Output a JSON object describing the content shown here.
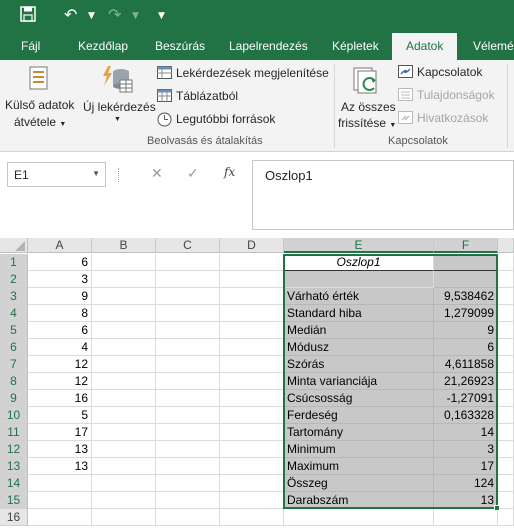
{
  "qat": {
    "save_icon": "save-icon",
    "undo_icon": "undo-icon",
    "redo_icon": "redo-icon",
    "customize_icon": "customize-qat-icon"
  },
  "tabs": [
    {
      "label": "Fájl",
      "active": false
    },
    {
      "label": "Kezdőlap",
      "active": false
    },
    {
      "label": "Beszúrás",
      "active": false
    },
    {
      "label": "Lapelrendezés",
      "active": false
    },
    {
      "label": "Képletek",
      "active": false
    },
    {
      "label": "Adatok",
      "active": true
    },
    {
      "label": "Vélemén",
      "active": false
    }
  ],
  "ribbon": {
    "external_data": {
      "line1": "Külső adatok",
      "line2": "átvétele"
    },
    "new_query": "Új lekérdezés",
    "show_queries": "Lekérdezések megjelenítése",
    "from_table": "Táblázatból",
    "recent_sources": "Legutóbbi források",
    "group_get_transform": "Beolvasás és átalakítás",
    "refresh_all": {
      "line1": "Az összes",
      "line2": "frissítése"
    },
    "connections": "Kapcsolatok",
    "properties": "Tulajdonságok",
    "edit_links": "Hivatkozások",
    "group_connections": "Kapcsolatok"
  },
  "formula_bar": {
    "name_box": "E1",
    "cancel": "✕",
    "enter": "✓",
    "fx": "fx",
    "value": "Oszlop1"
  },
  "columns": [
    "A",
    "B",
    "C",
    "D",
    "E",
    "F"
  ],
  "rows": [
    "1",
    "2",
    "3",
    "4",
    "5",
    "6",
    "7",
    "8",
    "9",
    "10",
    "11",
    "12",
    "13",
    "14",
    "15",
    "16"
  ],
  "col_a": [
    "6",
    "3",
    "9",
    "8",
    "6",
    "4",
    "12",
    "12",
    "16",
    "5",
    "17",
    "13",
    "13"
  ],
  "stats": {
    "header": "Oszlop1",
    "labels": [
      "Várható érték",
      "Standard hiba",
      "Medián",
      "Módusz",
      "Szórás",
      "Minta varianciája",
      "Csúcsosság",
      "Ferdeség",
      "Tartomány",
      "Minimum",
      "Maximum",
      "Összeg",
      "Darabszám"
    ],
    "values": [
      "9,538462",
      "1,279099",
      "9",
      "6",
      "4,611858",
      "21,26923",
      "-1,27091",
      "0,163328",
      "14",
      "3",
      "17",
      "124",
      "13"
    ]
  },
  "colors": {
    "accent": "#217346",
    "ribbon_bg": "#f3f3f3",
    "selection_fill": "#c8c8c8"
  }
}
